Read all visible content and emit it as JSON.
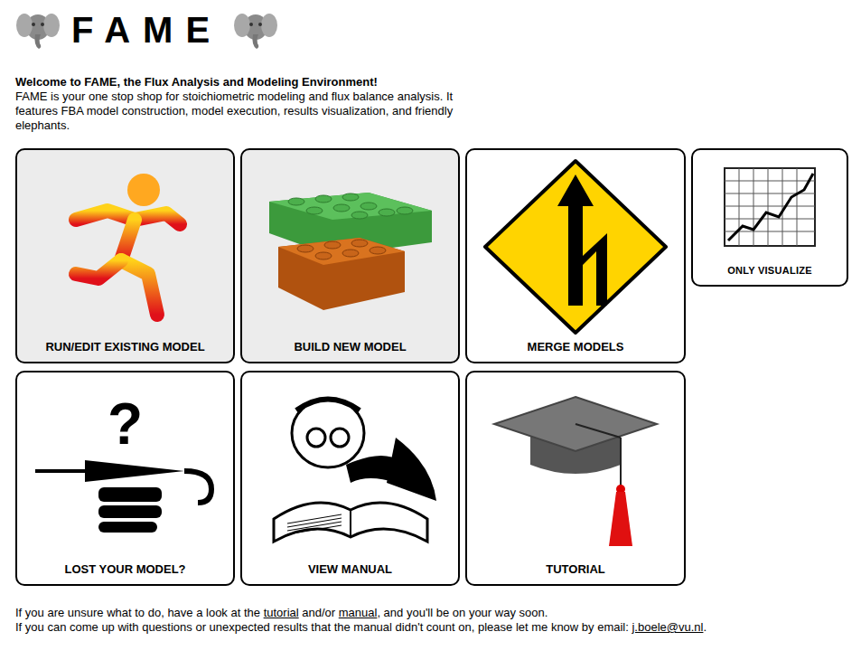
{
  "header": {
    "title": "FAME"
  },
  "intro": {
    "heading": "Welcome to FAME, the Flux Analysis and Modeling Environment!",
    "text": "FAME is your one stop shop for stoichiometric modeling and flux balance analysis. It features FBA model construction, model execution, results visualization, and friendly elephants."
  },
  "tiles": [
    {
      "label": "RUN/EDIT EXISTING MODEL",
      "shaded": true
    },
    {
      "label": "BUILD NEW MODEL",
      "shaded": true
    },
    {
      "label": "MERGE MODELS",
      "shaded": false
    },
    {
      "label": "LOST YOUR MODEL?",
      "shaded": false,
      "glyph": "?"
    },
    {
      "label": "VIEW MANUAL",
      "shaded": false
    },
    {
      "label": "TUTORIAL",
      "shaded": false
    }
  ],
  "side_tile": {
    "label": "ONLY VISUALIZE",
    "shaded": false
  },
  "footer": [
    [
      {
        "text": "If you are unsure what to do, have a look at the ",
        "link": false
      },
      {
        "text": "tutorial",
        "link": true
      },
      {
        "text": " and/or ",
        "link": false
      },
      {
        "text": "manual",
        "link": true
      },
      {
        "text": ", and you'll be on your way soon.",
        "link": false
      }
    ],
    [
      {
        "text": "If you can come up with questions or unexpected results that the manual didn't count on, please let me know by email: ",
        "link": false
      },
      {
        "text": "j.boele@vu.nl",
        "link": true
      },
      {
        "text": ".",
        "link": false
      }
    ]
  ]
}
